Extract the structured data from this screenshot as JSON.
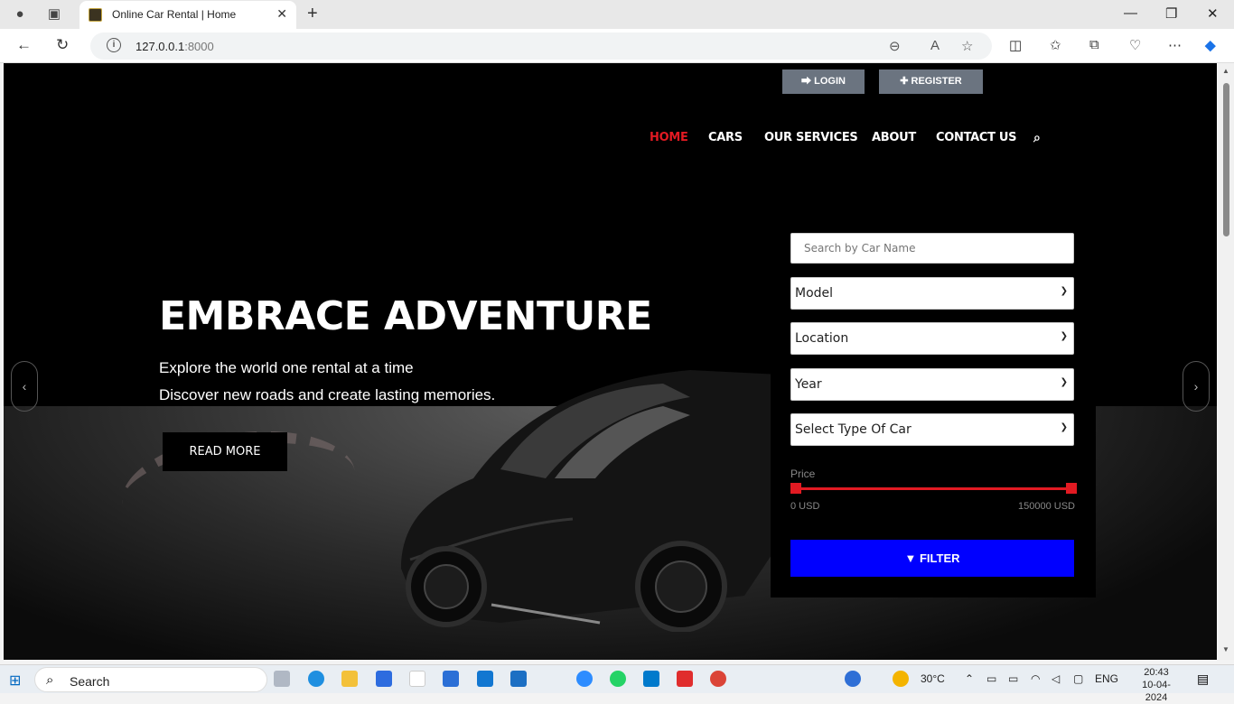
{
  "browser": {
    "tab_title": "Online Car Rental | Home",
    "url_host": "127.0.0.1",
    "url_port": ":8000"
  },
  "header": {
    "login_label": "LOGIN",
    "register_label": "REGISTER",
    "nav": [
      "HOME",
      "CARS",
      "OUR SERVICES",
      "ABOUT",
      "CONTACT US"
    ],
    "active_nav": "HOME",
    "accent_color": "#e21a22"
  },
  "hero": {
    "title": "EMBRACE ADVENTURE",
    "line1": "Explore the world one rental at a time",
    "line2": "Discover new roads and create lasting memories.",
    "read_more": "READ MORE"
  },
  "filter": {
    "search_placeholder": "Search by Car Name",
    "model": "Model",
    "location": "Location",
    "year": "Year",
    "car_type": "Select Type Of Car",
    "price_label": "Price",
    "price_min": "0 USD",
    "price_max": "150000 USD",
    "button_label": "FILTER",
    "button_color": "#0000ff"
  },
  "taskbar": {
    "search_label": "Search",
    "temperature": "30°C",
    "language": "ENG",
    "time": "20:43",
    "date": "10-04-2024"
  }
}
